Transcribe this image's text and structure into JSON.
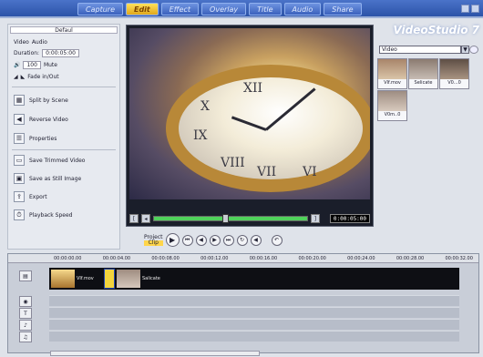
{
  "app": {
    "logo": "VideoStudio 7"
  },
  "steps": [
    "Capture",
    "Edit",
    "Effect",
    "Overlay",
    "Title",
    "Audio",
    "Share"
  ],
  "active_step": "Edit",
  "left_panel": {
    "header": "Defaul",
    "video_label": "Video",
    "audio_label": "Audio",
    "duration_label": "Duration:",
    "duration_value": "0:00:05:00",
    "volume_value": "100",
    "mute_label": "Mute",
    "fade_label": "Fade in/Out",
    "buttons": [
      "Split by Scene",
      "Reverse Video",
      "Properties",
      "Save Trimmed Video",
      "Save as Still Image",
      "Export",
      "Playback Speed"
    ]
  },
  "preview": {
    "timecode": "0:00:05:00",
    "watch_numerals": [
      "XII",
      "X",
      "IX",
      "VIII",
      "VII",
      "VI"
    ]
  },
  "player": {
    "project_label": "Project",
    "clip_label": "Clip",
    "buttons": [
      "play",
      "home",
      "previous",
      "next",
      "end",
      "repeat",
      "volume",
      "undo"
    ]
  },
  "library": {
    "category": "Video",
    "items": [
      "VIf.mov",
      "Selicate",
      "V0...0",
      "V0m..0"
    ]
  },
  "timeline": {
    "ruler": [
      "00:00:00.00",
      "00:00:04.00",
      "00:00:08.00",
      "00:00:12.00",
      "00:00:16.00",
      "00:00:20.00",
      "00:00:24.00",
      "00:00:28.00",
      "00:00:32.00"
    ],
    "clips": [
      "VIf.mov",
      "Salicate"
    ]
  }
}
